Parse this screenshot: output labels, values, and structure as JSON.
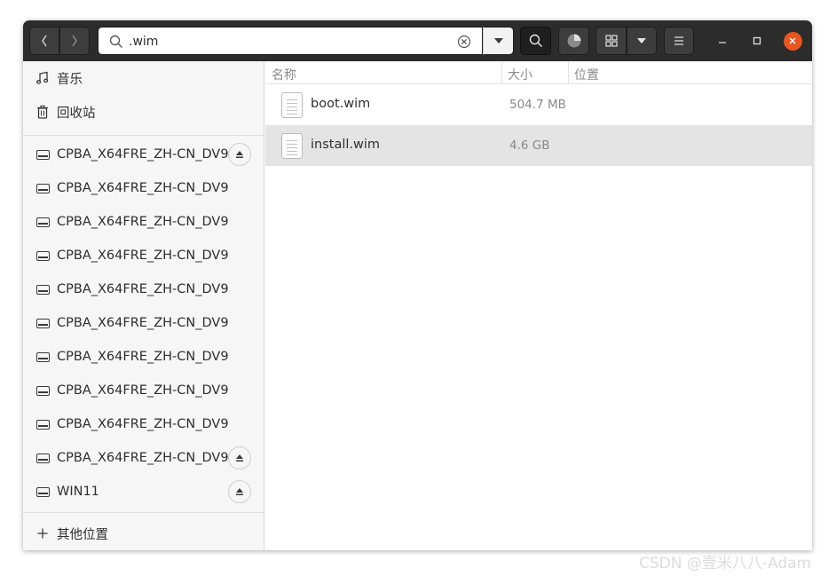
{
  "search": {
    "value": ".wim"
  },
  "sidebar": {
    "items": [
      {
        "label": "音乐",
        "icon": "music-note-icon"
      },
      {
        "label": "回收站",
        "icon": "trash-icon"
      }
    ],
    "devices": [
      {
        "label": "CPBA_X64FRE_ZH-CN_DV9",
        "ejectable": true
      },
      {
        "label": "CPBA_X64FRE_ZH-CN_DV9",
        "ejectable": false
      },
      {
        "label": "CPBA_X64FRE_ZH-CN_DV9",
        "ejectable": false
      },
      {
        "label": "CPBA_X64FRE_ZH-CN_DV9",
        "ejectable": false
      },
      {
        "label": "CPBA_X64FRE_ZH-CN_DV9",
        "ejectable": false
      },
      {
        "label": "CPBA_X64FRE_ZH-CN_DV9",
        "ejectable": false
      },
      {
        "label": "CPBA_X64FRE_ZH-CN_DV9",
        "ejectable": false
      },
      {
        "label": "CPBA_X64FRE_ZH-CN_DV9",
        "ejectable": false
      },
      {
        "label": "CPBA_X64FRE_ZH-CN_DV9",
        "ejectable": false
      },
      {
        "label": "CPBA_X64FRE_ZH-CN_DV9",
        "ejectable": true
      },
      {
        "label": "WIN11",
        "ejectable": true
      }
    ],
    "other_locations": "其他位置"
  },
  "columns": {
    "name": "名称",
    "size": "大小",
    "location": "位置"
  },
  "files": [
    {
      "name": "boot.wim",
      "size": "504.7 MB",
      "location": "",
      "selected": false
    },
    {
      "name": "install.wim",
      "size": "4.6 GB",
      "location": "",
      "selected": true
    }
  ],
  "watermark": "CSDN @壹米八八-Adam",
  "colors": {
    "headerbar": "#2c2c2c",
    "close_button": "#e95420",
    "selection": "#e4e4e4"
  }
}
